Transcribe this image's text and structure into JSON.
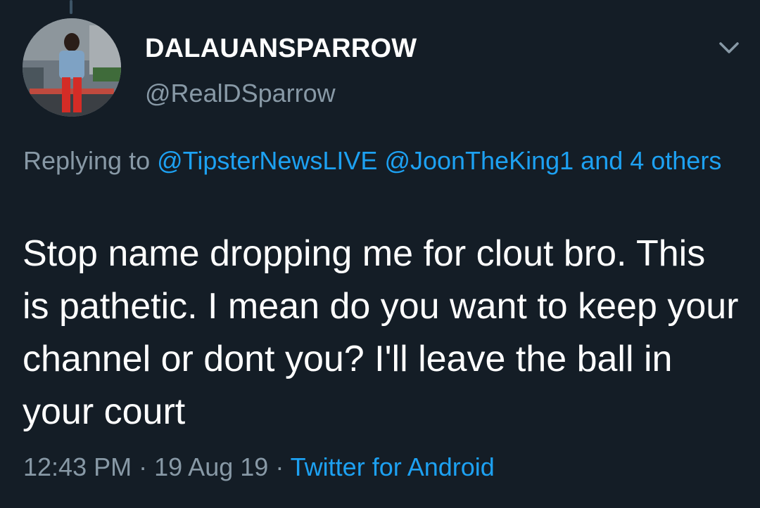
{
  "user": {
    "display_name": "DALAUANSPARROW",
    "handle": "@RealDSparrow"
  },
  "reply": {
    "prefix": "Replying to",
    "mention_1": "@TipsterNewsLIVE",
    "mention_2": "@JoonTheKing1",
    "others": "and 4 others"
  },
  "tweet": {
    "text": "Stop name dropping me for clout bro. This is pathetic. I mean do you want to keep your channel or dont you? I'll leave the ball in your court"
  },
  "meta": {
    "time": "12:43 PM",
    "separator": "·",
    "date": "19 Aug 19",
    "source": "Twitter for Android"
  },
  "icons": {
    "menu": "chevron-down-icon",
    "avatar": "avatar-photo"
  },
  "colors": {
    "background": "#141d26",
    "secondary_text": "#8899a6",
    "link": "#1da1f2",
    "primary_text": "#ffffff"
  }
}
